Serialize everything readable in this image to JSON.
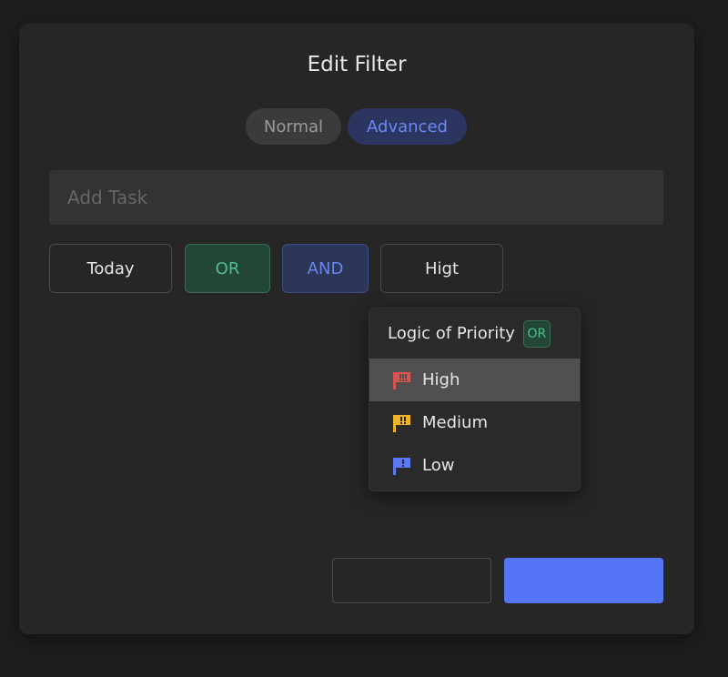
{
  "dialog": {
    "title": "Edit Filter",
    "mode_toggle": {
      "normal_label": "Normal",
      "advanced_label": "Advanced",
      "selected": "Advanced"
    },
    "task_input": {
      "value": "",
      "placeholder": "Add Task"
    },
    "chips": [
      {
        "label": "Today"
      },
      {
        "label": "OR"
      },
      {
        "label": "AND"
      },
      {
        "label": "Higt"
      }
    ],
    "priority_dropdown": {
      "header_label": "Logic of Priority",
      "header_logic_tag": "OR",
      "items": [
        {
          "label": "High",
          "icon": "flag-high-icon",
          "color": "#d9534f",
          "selected": true
        },
        {
          "label": "Medium",
          "icon": "flag-medium-icon",
          "color": "#f0b429",
          "selected": false
        },
        {
          "label": "Low",
          "icon": "flag-low-icon",
          "color": "#5b78f6",
          "selected": false
        }
      ]
    },
    "footer": {
      "cancel_label": "",
      "confirm_label": ""
    }
  },
  "colors": {
    "accent": "#5475f6",
    "or_green": "#4fbf8e",
    "and_blue": "#6a86ee"
  }
}
